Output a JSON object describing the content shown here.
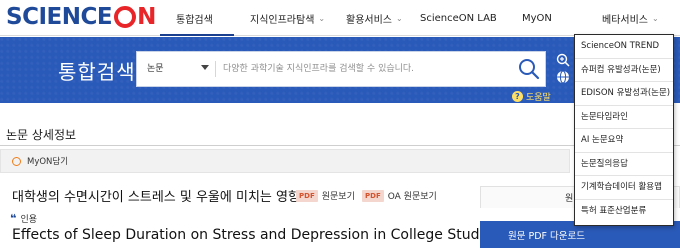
{
  "logo": {
    "science": "SCIENCE",
    "on": "N"
  },
  "nav": {
    "items": [
      {
        "label": "통합검색"
      },
      {
        "label": "지식인프라탐색",
        "chevron": "chevron-down-icon"
      },
      {
        "label": "활용서비스",
        "chevron": "chevron-down-icon"
      },
      {
        "label": "ScienceON LAB"
      },
      {
        "label": "MyON"
      },
      {
        "label": "베타서비스",
        "chevron": "chevron-down-icon"
      }
    ],
    "chevron_glyph": "⌄"
  },
  "hero": {
    "title": "통합검색",
    "scope": "논문",
    "search_placeholder": "다양한 과학기술 지식인프라를 검색할 수 있습니다.",
    "help": "도움말",
    "help_icon_glyph": "?"
  },
  "dropdown": {
    "items": [
      "ScienceON TREND",
      "슈퍼컴 유발성과(논문)",
      "EDISON 유발성과(논문)",
      "논문타임라인",
      "AI 논문요약",
      "논문질의응답",
      "기계학습데이터 활용맵",
      "특허 표준산업분류"
    ]
  },
  "detail": {
    "section_title": "논문 상세정보",
    "myon_label": "MyON담기",
    "title_ko": "대학생의 수면시간이 스트레스 및 우울에 미치는 영향",
    "pdf_badge": "PDF",
    "pdf_view": "원문보기",
    "oa_view": "OA 원문보기",
    "cite_mark": "❝",
    "cite_label": "인용",
    "title_en": "Effects of Sleep Duration on Stress and Depression in College Students",
    "side_top": "원",
    "download_label": "원문 PDF 다운로드"
  },
  "colors": {
    "brand_blue": "#1f4a9a",
    "logo_red": "#e8262a",
    "hero_blue": "#2a5ab9",
    "help_yellow": "#ffe066",
    "pdf_red": "#d4532f"
  }
}
